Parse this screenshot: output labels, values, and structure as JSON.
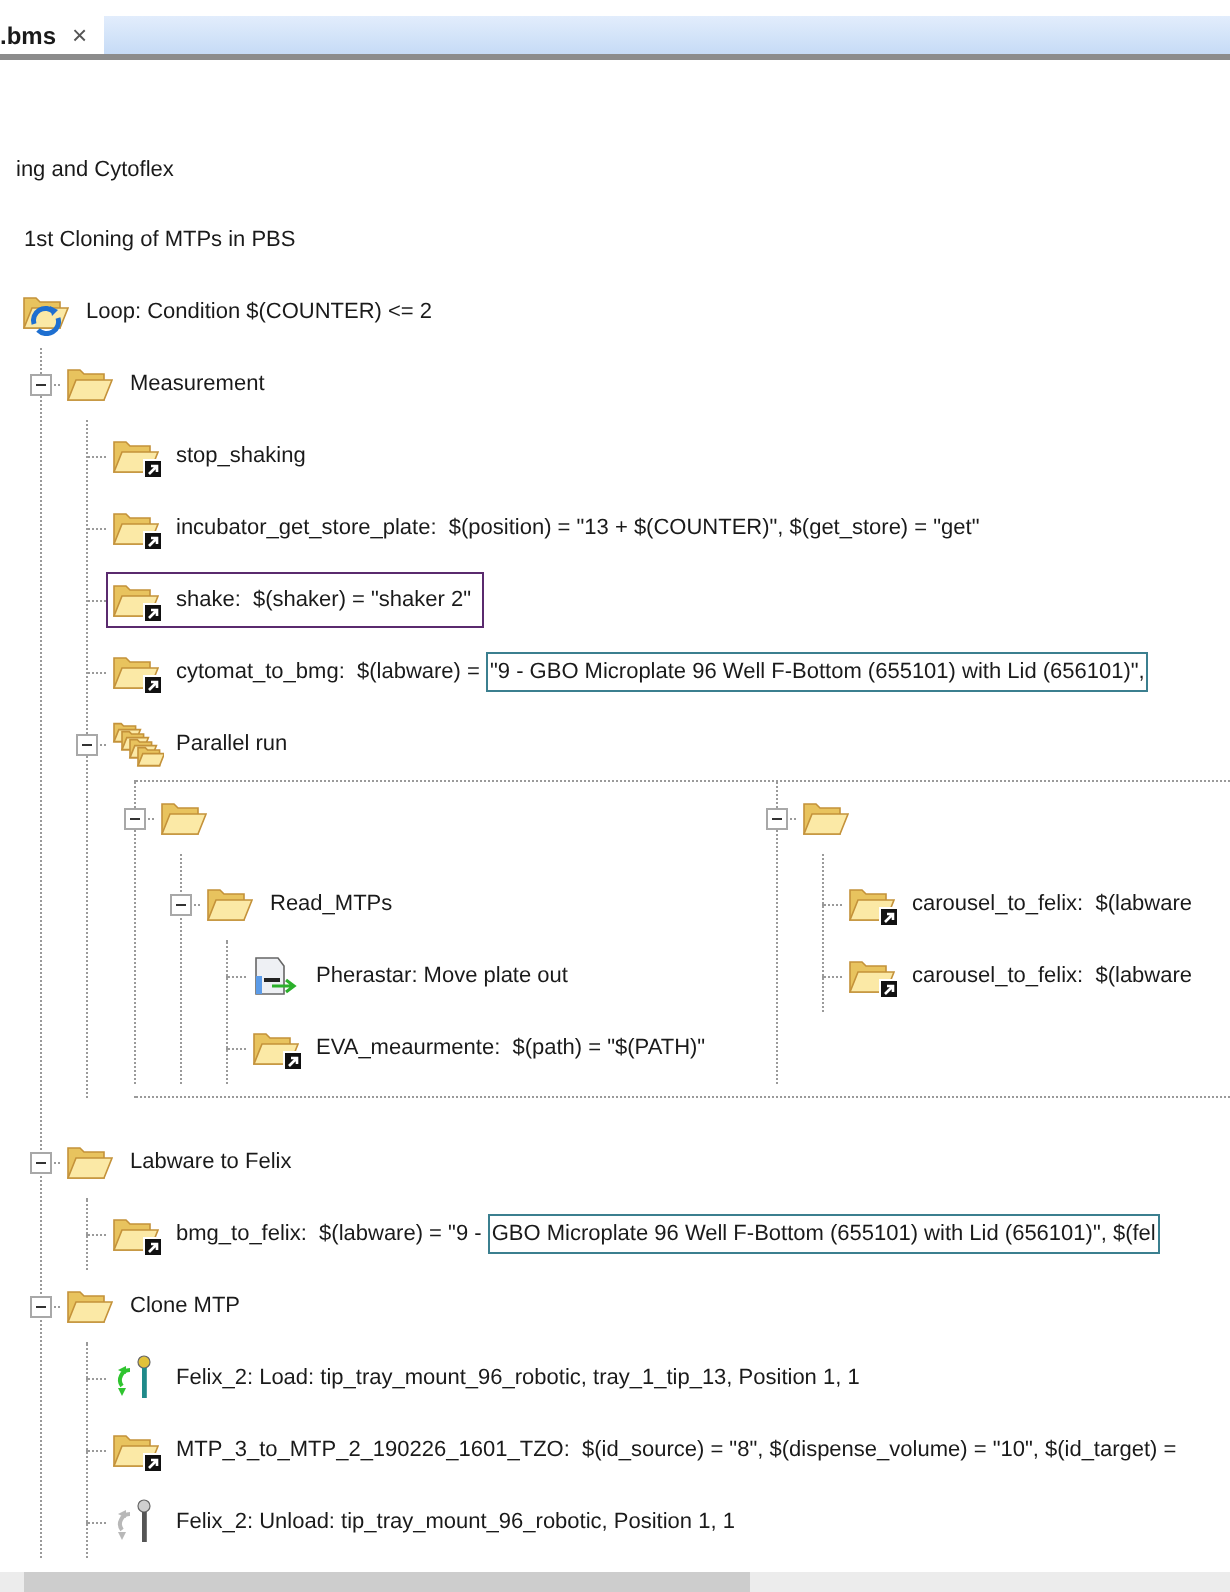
{
  "tab": {
    "title": ".bms",
    "close": "×"
  },
  "ancestors": [
    {
      "label": "ing and Cytoflex"
    },
    {
      "label": "1st Cloning of MTPs in PBS"
    }
  ],
  "tree": {
    "kind": "loop",
    "label": "Loop: Condition $(COUNTER) <= 2",
    "selected": false,
    "children": [
      {
        "kind": "folder",
        "label": "Measurement",
        "expanded": true,
        "selected": false,
        "children": [
          {
            "kind": "shortcut",
            "label": "stop_shaking",
            "selected": false
          },
          {
            "kind": "shortcut",
            "label": "incubator_get_store_plate:  $(position) = \"13 + $(COUNTER)\", $(get_store) = \"get\"",
            "selected": false
          },
          {
            "kind": "shortcut",
            "label": "shake:  $(shaker) = \"shaker 2\"",
            "selected": true
          },
          {
            "kind": "shortcut",
            "label": "cytomat_to_bmg:  $(labware) = ",
            "highlight": "\"9 - GBO Microplate 96 Well F-Bottom (655101) with Lid (656101)\",",
            "selected": false
          },
          {
            "kind": "parallel",
            "label": "Parallel run",
            "expanded": true,
            "selected": false,
            "children": [
              {
                "kind": "folder",
                "expanded": true,
                "selected": false,
                "children": [
                  {
                    "kind": "folder",
                    "label": "Read_MTPs",
                    "expanded": true,
                    "selected": false,
                    "children": [
                      {
                        "kind": "device",
                        "label": "Pherastar: Move plate out",
                        "selected": false
                      },
                      {
                        "kind": "shortcut",
                        "label": "EVA_meaurmente:  $(path) = \"$(PATH)\"",
                        "selected": false
                      }
                    ]
                  }
                ]
              },
              {
                "kind": "folder",
                "expanded": true,
                "selected": false,
                "children": [
                  {
                    "kind": "shortcut",
                    "label": "carousel_to_felix:  $(labware",
                    "selected": false
                  },
                  {
                    "kind": "shortcut",
                    "label": "carousel_to_felix:  $(labware",
                    "selected": false
                  }
                ]
              }
            ]
          }
        ]
      },
      {
        "kind": "folder",
        "label": "Labware to Felix",
        "expanded": true,
        "selected": false,
        "children": [
          {
            "kind": "shortcut",
            "label": "bmg_to_felix:  $(labware) = \"9 - ",
            "highlight": "GBO Microplate 96 Well F-Bottom (655101) with Lid (656101)\", $(fel",
            "selected": false
          }
        ]
      },
      {
        "kind": "folder",
        "label": "Clone MTP",
        "expanded": true,
        "selected": false,
        "children": [
          {
            "kind": "tip_load",
            "label": "Felix_2: Load: tip_tray_mount_96_robotic, tray_1_tip_13, Position 1, 1",
            "selected": false
          },
          {
            "kind": "shortcut",
            "label": "MTP_3_to_MTP_2_190226_1601_TZO:  $(id_source) = \"8\", $(dispense_volume) = \"10\", $(id_target) =",
            "selected": false
          },
          {
            "kind": "tip_unload",
            "label": "Felix_2: Unload: tip_tray_mount_96_robotic, Position 1, 1",
            "selected": false
          }
        ]
      }
    ]
  }
}
